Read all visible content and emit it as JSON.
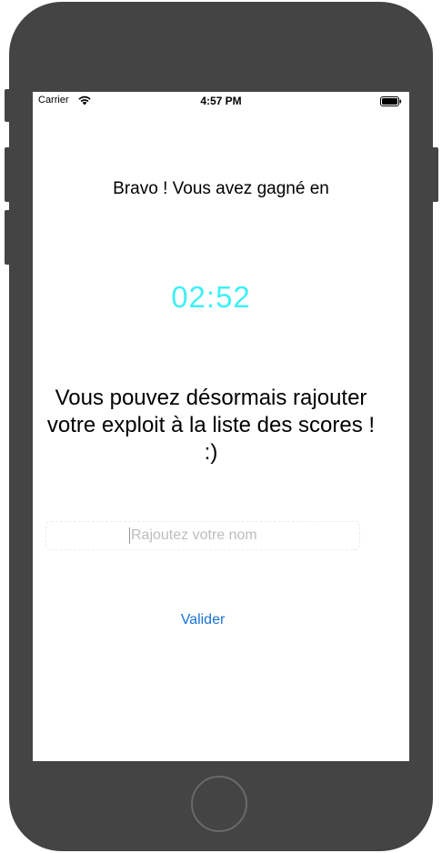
{
  "status_bar": {
    "carrier": "Carrier",
    "time": "4:57 PM",
    "wifi_icon": "wifi-icon",
    "battery_icon": "battery-icon"
  },
  "screen": {
    "headline": "Bravo ! Vous avez gagné en",
    "timer": "02:52",
    "timer_color": "#3ef0f5",
    "message": "Vous pouvez désormais rajouter votre exploit à la liste des scores ! :)",
    "name_placeholder": "Rajoutez votre nom",
    "submit_label": "Valider",
    "submit_color": "#1a73d9"
  },
  "device": {
    "home_button_icon": "home-button"
  }
}
